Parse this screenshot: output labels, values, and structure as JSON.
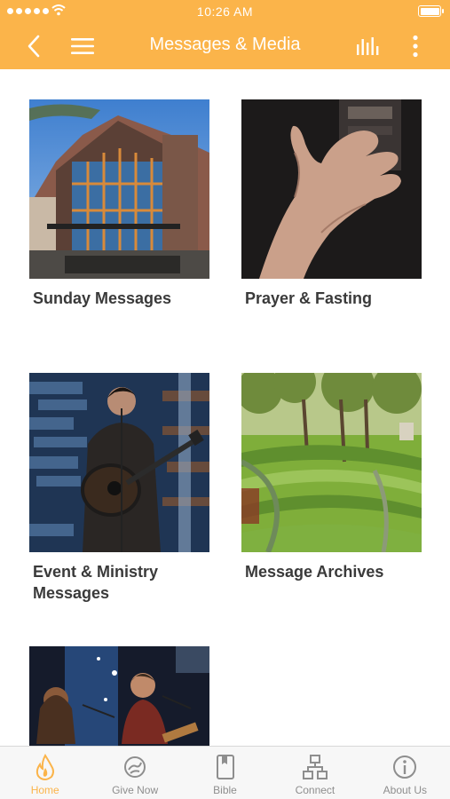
{
  "status_bar": {
    "time": "10:26 AM",
    "signal_dots": 5,
    "battery_level": 1.0
  },
  "nav": {
    "title": "Messages & Media",
    "back_icon": "chevron-left-icon",
    "menu_icon": "hamburger-menu-icon",
    "audio_icon": "audio-bars-icon",
    "more_icon": "vertical-ellipsis-icon"
  },
  "tiles": [
    {
      "label": "Sunday Messages",
      "image": "church-building-photo"
    },
    {
      "label": "Prayer & Fasting",
      "image": "open-hand-photo"
    },
    {
      "label": "Event & Ministry Messages",
      "image": "guitar-performer-photo"
    },
    {
      "label": "Message Archives",
      "image": "park-steps-photo"
    },
    {
      "label": "",
      "image": "worship-duo-photo"
    }
  ],
  "tabs": [
    {
      "label": "Home",
      "icon": "flame-icon",
      "active": true
    },
    {
      "label": "Give Now",
      "icon": "give-icon",
      "active": false
    },
    {
      "label": "Bible",
      "icon": "book-icon",
      "active": false
    },
    {
      "label": "Connect",
      "icon": "network-icon",
      "active": false
    },
    {
      "label": "About Us",
      "icon": "info-icon",
      "active": false
    }
  ],
  "colors": {
    "accent": "#fbb44a",
    "label_text": "#3a3a3a",
    "tab_inactive": "#8e8e8e"
  }
}
